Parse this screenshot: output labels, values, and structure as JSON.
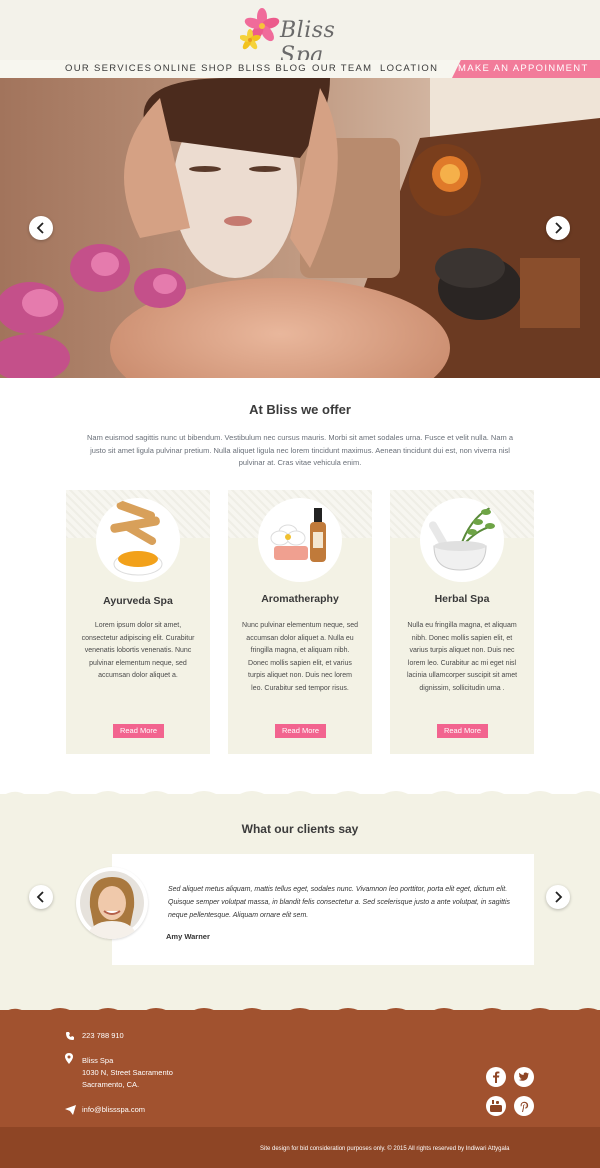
{
  "brand": {
    "name": "Bliss Spa"
  },
  "nav": {
    "items": [
      "OUR SERVICES",
      "ONLINE SHOP",
      "BLISS BLOG",
      "OUR TEAM",
      "LOCATION"
    ],
    "cta": "MAKE AN APPOINMENT"
  },
  "colors": {
    "accent": "#f2648f",
    "cream": "#f3f2e5",
    "footer": "#a1522f",
    "footer_dark": "#8e4525"
  },
  "hero": {
    "prev_icon": "chevron-left-icon",
    "next_icon": "chevron-right-icon"
  },
  "offer": {
    "title": "At Bliss we offer",
    "intro": "Nam euismod sagittis nunc ut bibendum. Vestibulum nec cursus mauris. Morbi sit amet sodales urna. Fusce et velit nulla. Nam a justo sit amet ligula pulvinar pretium. Nulla aliquet ligula nec lorem tincidunt maximus. Aenean tincidunt dui est, non viverra nisl pulvinar at. Cras vitae vehicula enim.",
    "cards": [
      {
        "title": "Ayurveda Spa",
        "text": "Lorem ipsum dolor sit amet, consectetur adipiscing elit. Curabitur venenatis lobortis venenatis. Nunc pulvinar elementum neque, sed accumsan dolor aliquet a.",
        "button": "Read More"
      },
      {
        "title": "Aromatheraphy",
        "text": "Nunc pulvinar elementum neque, sed accumsan dolor aliquet a. Nulla eu fringilla magna, et aliquam nibh. Donec mollis sapien elit, et varius turpis aliquet non. Duis nec lorem leo. Curabitur sed tempor risus.",
        "button": "Read More"
      },
      {
        "title": "Herbal Spa",
        "text": "Nulla eu fringilla magna, et aliquam nibh. Donec mollis sapien elit, et varius turpis aliquet non. Duis nec lorem leo. Curabitur ac mi eget nisl lacinia ullamcorper suscipit sit amet dignissim, sollicitudin urna .",
        "button": "Read More"
      }
    ]
  },
  "testimonials": {
    "title": "What our clients say",
    "quote": "Sed aliquet metus aliquam, mattis tellus eget, sodales nunc. Vivamnon leo porttitor, porta elit eget, dictum elit. Quisque semper volutpat massa, in blandit felis consectetur a. Sed scelerisque justo a ante volutpat, in sagittis neque pellentesque. Aliquam ornare elit sem.",
    "author": "Amy Warner"
  },
  "footer": {
    "phone": "223 788 910",
    "address_name": "Bliss Spa",
    "address_line1": "1030 N,  Street Sacramento",
    "address_line2": "Sacramento, CA.",
    "email": "info@blissspa.com",
    "social": [
      "facebook-icon",
      "twitter-icon",
      "youtube-icon",
      "pinterest-icon"
    ],
    "copyright": "Site design for bid consideration purposes only. © 2015  All rights reserved by Indiwari Attygala"
  }
}
